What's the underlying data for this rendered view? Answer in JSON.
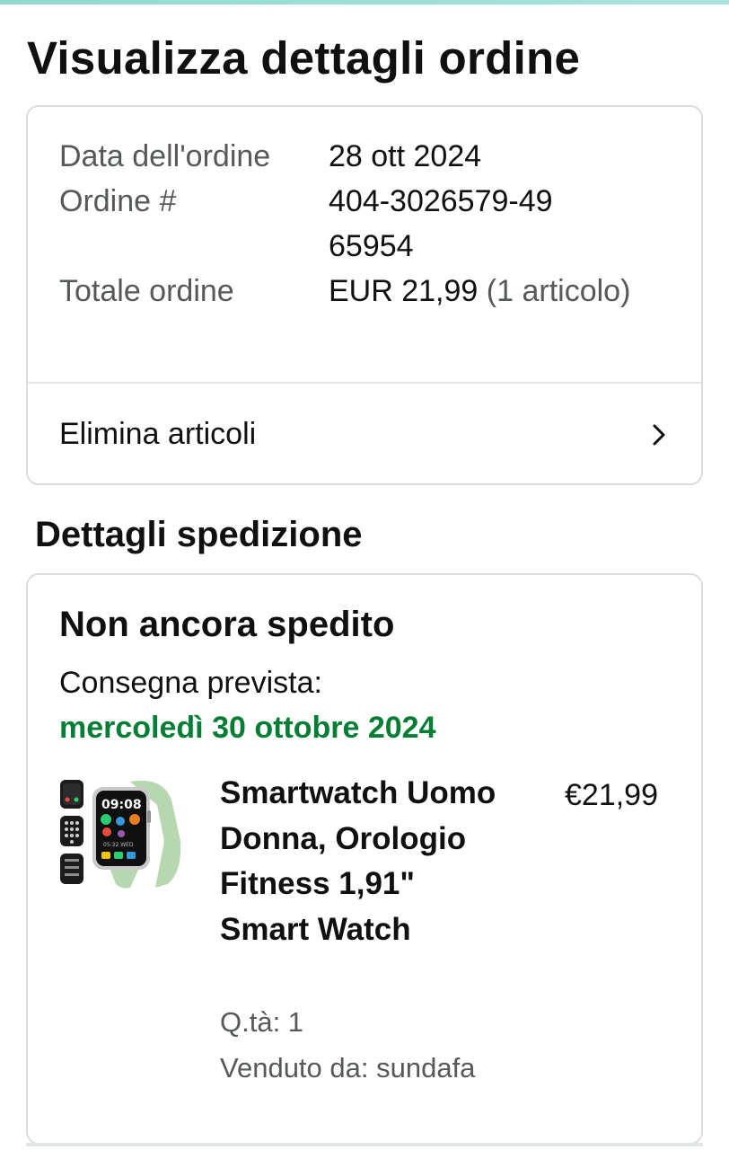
{
  "header": {
    "title": "Visualizza dettagli ordine"
  },
  "summary": {
    "order_date_label": "Data dell'ordine",
    "order_date": "28 ott 2024",
    "order_number_label": "Ordine #",
    "order_number": "404-3026579-4965954",
    "order_total_label": "Totale ordine",
    "order_total": "EUR 21,99",
    "order_item_count": "(1 articolo)",
    "delete_items_label": "Elimina articoli"
  },
  "shipping": {
    "section_title": "Dettagli spedizione",
    "status": "Non ancora spedito",
    "eta_label": "Consegna prevista:",
    "eta_date": "mercoledì 30 ottobre 2024",
    "item": {
      "name": "Smartwatch Uomo Donna, Orologio Fitness 1,91\" Smart Watch",
      "price": "€21,99",
      "quantity": "Q.tà: 1",
      "seller": "Venduto da: sundafa",
      "image_icon": "smartwatch-product-image",
      "watch_time": "09:08",
      "watch_subtext": "05:32 WED"
    }
  },
  "colors": {
    "eta_green": "#067d34",
    "muted_text": "#565959",
    "card_border": "#dddddd",
    "watch_strap": "#b7d7b0"
  }
}
